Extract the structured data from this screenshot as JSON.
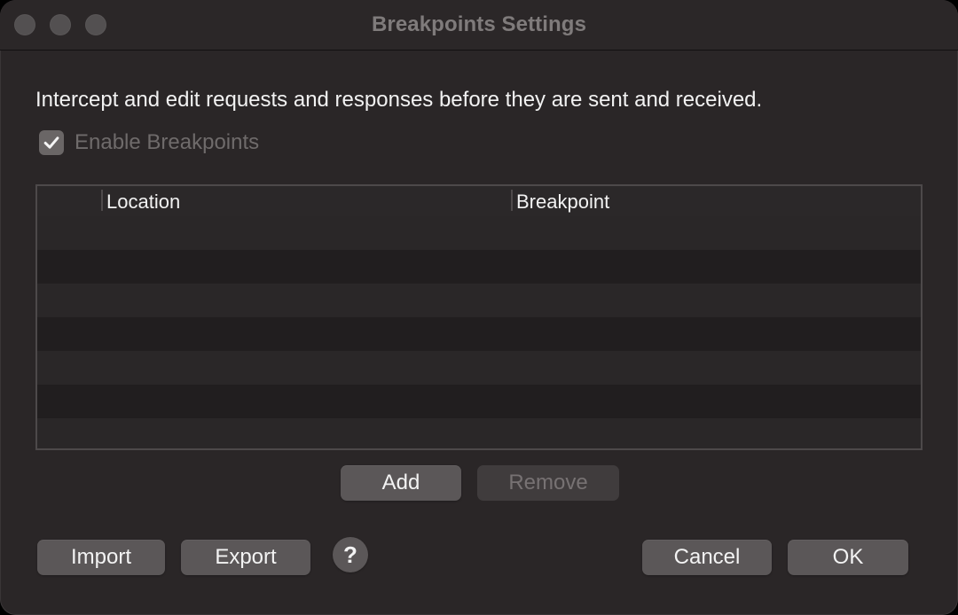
{
  "window": {
    "title": "Breakpoints Settings"
  },
  "content": {
    "description": "Intercept and edit requests and responses before they are sent and received.",
    "enable_breakpoints": {
      "label": "Enable Breakpoints",
      "checked": true
    },
    "table": {
      "columns": [
        "",
        "Location",
        "Breakpoint"
      ],
      "rows": []
    }
  },
  "buttons": {
    "add": "Add",
    "remove": "Remove",
    "import": "Import",
    "export": "Export",
    "help": "?",
    "cancel": "Cancel",
    "ok": "OK"
  },
  "icons": {
    "traffic_lights": [
      "close-icon",
      "minimize-icon",
      "zoom-icon"
    ],
    "checkbox": "checkmark-icon",
    "help": "question-mark-icon"
  },
  "colors": {
    "window_background": "#2a2627",
    "button_background": "#5b5758",
    "disabled_text": "#777273"
  }
}
